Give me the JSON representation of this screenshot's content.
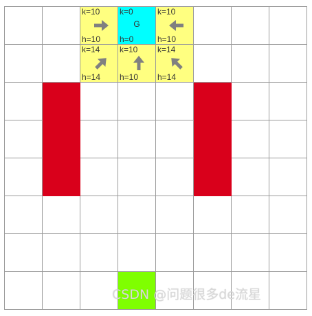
{
  "colors": {
    "open_node": "#ffff80",
    "goal_node": "#00ffff",
    "start_node": "#7fff00",
    "obstacle": "#d9001b",
    "arrow": "#808080",
    "grid_line": "#9a9a9a"
  },
  "grid": {
    "rows": 8,
    "cols": 8
  },
  "nodes": [
    {
      "id": "n-0-2",
      "row": 0,
      "col": 2,
      "k": "k=10",
      "h": "h=10",
      "arrow": "right-arrow-icon"
    },
    {
      "id": "n-0-3",
      "row": 0,
      "col": 3,
      "k": "k=0",
      "h": "h=0",
      "label": "G",
      "goal": true
    },
    {
      "id": "n-0-4",
      "row": 0,
      "col": 4,
      "k": "k=10",
      "h": "h=10",
      "arrow": "left-arrow-icon"
    },
    {
      "id": "n-1-2",
      "row": 1,
      "col": 2,
      "k": "k=14",
      "h": "h=14",
      "arrow": "up-right-arrow-icon"
    },
    {
      "id": "n-1-3",
      "row": 1,
      "col": 3,
      "k": "k=10",
      "h": "h=10",
      "arrow": "up-arrow-icon"
    },
    {
      "id": "n-1-4",
      "row": 1,
      "col": 4,
      "k": "k=14",
      "h": "h=14",
      "arrow": "up-left-arrow-icon"
    }
  ],
  "obstacles": [
    {
      "id": "obstacle-left",
      "col": 1,
      "row_start": 2,
      "row_end": 4
    },
    {
      "id": "obstacle-right",
      "col": 5,
      "row_start": 2,
      "row_end": 4
    }
  ],
  "start": {
    "row": 7,
    "col": 3
  },
  "watermark": "CSDN @问题很多de流星"
}
